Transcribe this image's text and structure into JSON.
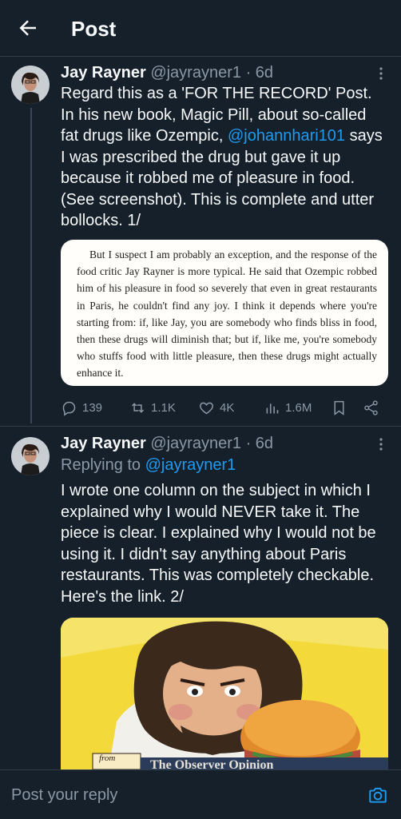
{
  "header": {
    "title": "Post",
    "back_icon": "back-arrow-icon"
  },
  "tweet1": {
    "name": "Jay Rayner",
    "handle": "@jayrayner1",
    "time": "· 6d",
    "text_line1": "Regard this as a 'FOR THE RECORD' Post. In his new book, Magic Pill, about so-called fat drugs like Ozempic, ",
    "mention": "@johannhari101",
    "text_line2": " says I was prescribed the drug but gave it up because it robbed me of pleasure in food. (See screenshot). This is complete and utter bollocks. 1/",
    "quote_image_text": "But I suspect I am probably an exception, and the response of the food critic Jay Rayner is more typical. He said that Ozempic robbed him of his pleasure in food so severely that even in great restaurants in Paris, he couldn't find any joy. I think it depends where you're starting from: if, like Jay, you are somebody who finds bliss in food, then these drugs will diminish that; but if, like me, you're somebody who stuffs food with little pleasure, then these drugs might actually enhance it.",
    "stats": {
      "replies": "139",
      "reposts": "1.1K",
      "likes": "4K",
      "views": "1.6M"
    }
  },
  "tweet2": {
    "name": "Jay Rayner",
    "handle": "@jayrayner1",
    "time": "· 6d",
    "replying_prefix": "Replying to ",
    "replying_to": "@jayrayner1",
    "text": "I wrote one column on the subject in which I explained why I would NEVER take it.  The piece is clear.  I explained why I would not be using it. I didn't say anything about Paris restaurants. This was completely checkable. Here's the link. 2/",
    "image_caption_small": "from",
    "image_caption_banner": "The Observer Opinion"
  },
  "reply": {
    "placeholder": "Post your reply"
  },
  "colors": {
    "background": "#15202b",
    "accent": "#1d9bf0",
    "muted": "#8b98a5",
    "divider": "#2f3c4a"
  }
}
